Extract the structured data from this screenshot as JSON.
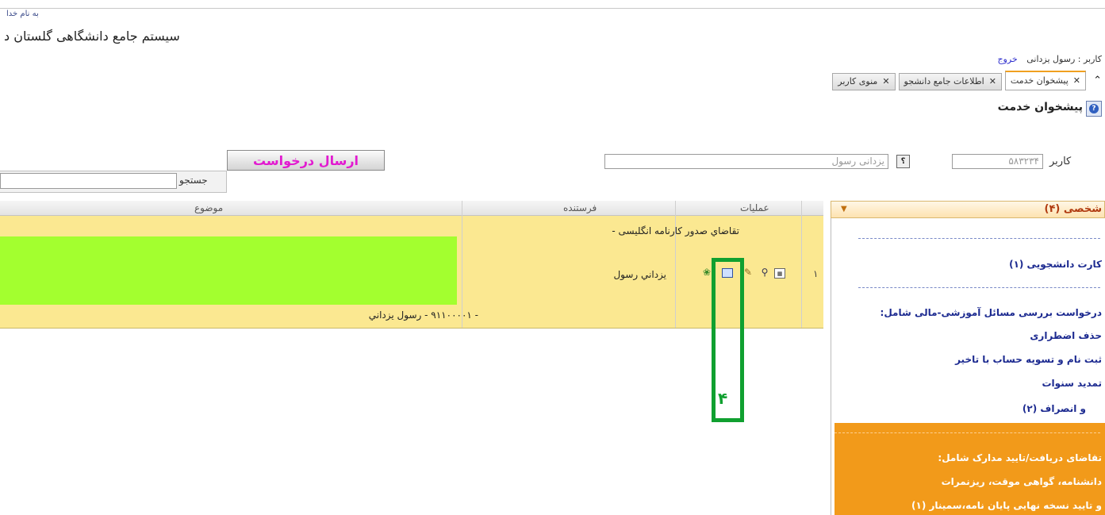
{
  "header": {
    "bismillah": "به نام خدا",
    "system_title": "سیستم جامع دانشگاهی گلستان   د"
  },
  "user_line": {
    "user_text": "کاربر : رسول یزدانی",
    "logout": "خروج"
  },
  "tabs": [
    {
      "label": "منوی کاربر",
      "active": false
    },
    {
      "label": "اطلاعات جامع دانشجو",
      "active": false
    },
    {
      "label": "پیشخوان خدمت",
      "active": true
    }
  ],
  "panel": {
    "title": "پیشخوان خدمت"
  },
  "form": {
    "user_label": "کاربر",
    "user_id_value": "۵۸۳۲۳۴",
    "lookup_label": "؟",
    "name_value": "یزدانی رسول",
    "send_button": "ارسال درخواست",
    "search_label": "جستجو",
    "search_value": ""
  },
  "table": {
    "columns": [
      "موضوع",
      "فرستنده",
      "عملیات"
    ],
    "rows": [
      {
        "index": "۱",
        "subject_top": "تقاضاي صدور کارنامه انگلیسی -",
        "subject_bottom": "- ۹۱۱۰۰۰۰۱ - رسول يزداني",
        "sender": "يزداني رسول",
        "operations": [
          "calendar-icon",
          "magnifier-icon",
          "pencil-icon",
          "window-icon",
          "leaf-icon"
        ]
      }
    ]
  },
  "annotation": {
    "label": "۴",
    "color": "#10a030"
  },
  "sidebar": {
    "title": "شخصی (۴)",
    "items": [
      {
        "label": "کارت دانشجویی (۱)"
      },
      {
        "label": "درخواست بررسی مسائل آموزشی-مالی شامل:"
      },
      {
        "label": "حذف اضطراری"
      },
      {
        "label": "ثبت نام و تسویه حساب با تاخیر"
      },
      {
        "label": "تمدید سنوات"
      },
      {
        "label": "و انصراف (۲)"
      },
      {
        "label": "تقاضای دریافت/تایید مدارک شامل:"
      },
      {
        "label": "دانشنامه، گواهی موقت، ریزنمرات"
      },
      {
        "label": "و تایید نسخه نهایی پایان نامه،سمینار (۱)"
      }
    ]
  },
  "colors": {
    "row_bg": "#fbe891",
    "green_block": "#a3ff2f",
    "send_text": "#e21ad0",
    "orange_block": "#f29a1a"
  }
}
